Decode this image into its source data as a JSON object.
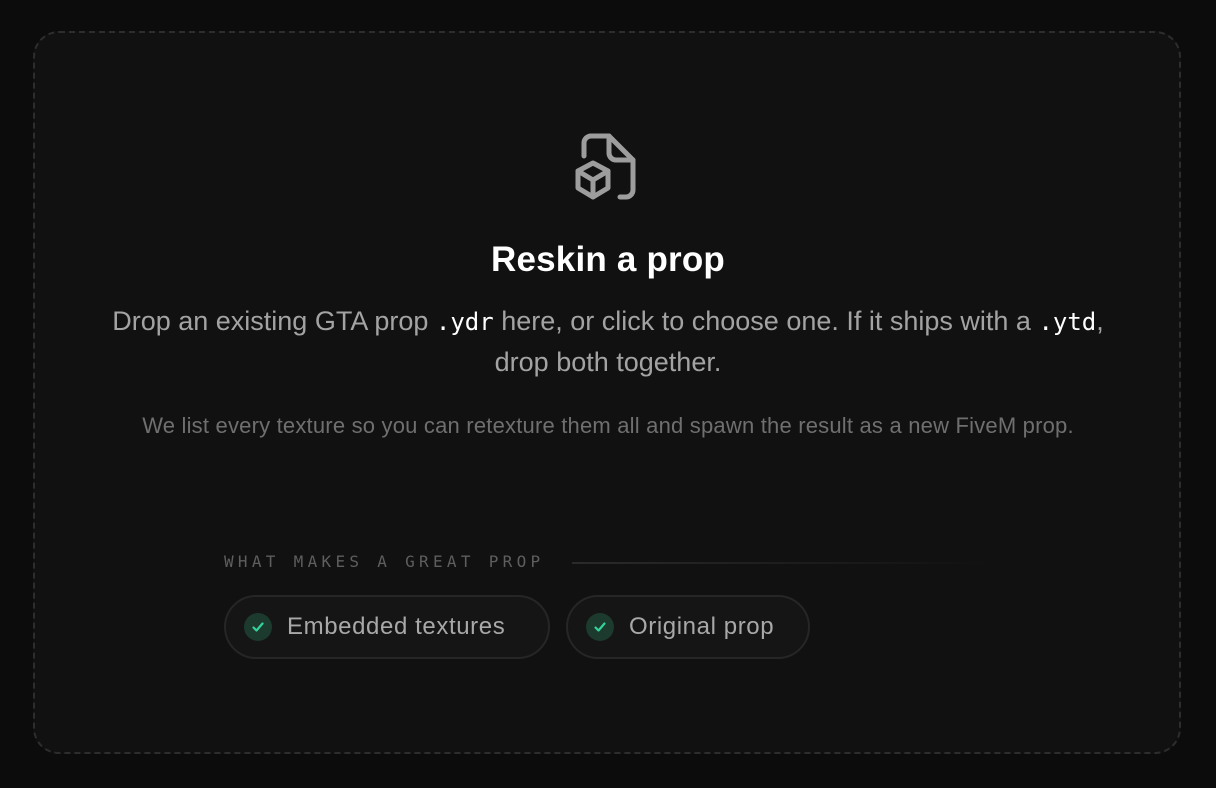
{
  "dropzone": {
    "title": "Reskin a prop",
    "lead": {
      "part1": "Drop an existing GTA prop ",
      "ext_ydr": ".ydr",
      "part2": " here, or click to choose one. If it ships with a ",
      "ext_ytd": ".ytd",
      "part3": ", drop both together."
    },
    "sub": "We list every texture so you can retexture them all and spawn the result as a new FiveM prop.",
    "icon": "file-box-icon"
  },
  "criteria": {
    "label": "WHAT MAKES A GREAT PROP",
    "items": [
      {
        "label": "Embedded textures",
        "icon": "check-icon"
      },
      {
        "label": "Original prop",
        "icon": "check-icon"
      }
    ]
  },
  "colors": {
    "accent_check": "#34d399",
    "check_bg": "#1c3a2e",
    "background": "#0c0c0c",
    "panel": "#111111"
  }
}
